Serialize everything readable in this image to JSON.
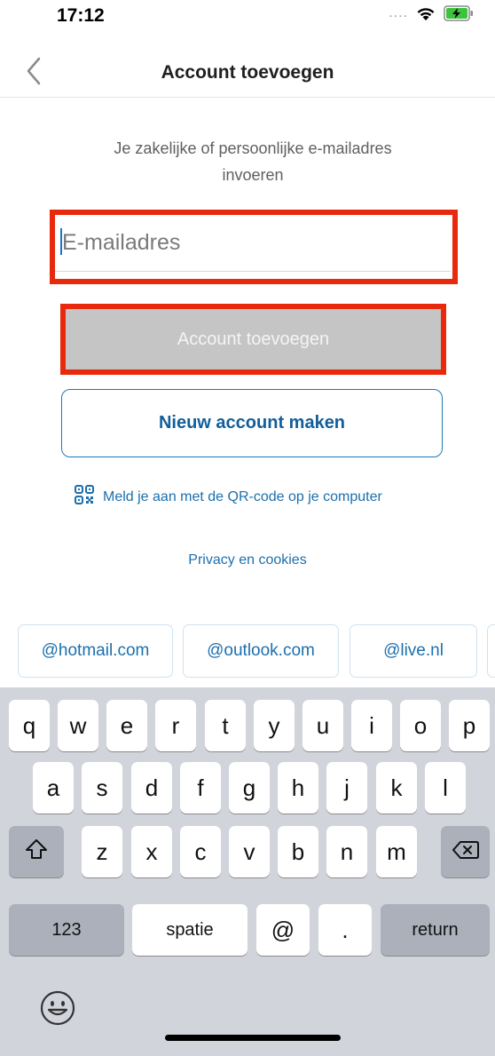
{
  "status_bar": {
    "time": "17:12",
    "signal": "....",
    "wifi_icon": "wifi-icon",
    "battery_icon": "battery-charging-icon"
  },
  "nav": {
    "back_icon": "chevron-left-icon",
    "title": "Account toevoegen"
  },
  "instruction": "Je zakelijke of persoonlijke e-mailadres invoeren",
  "email_field": {
    "value": "",
    "placeholder": "E-mailadres"
  },
  "buttons": {
    "add_account": "Account toevoegen",
    "create_account": "Nieuw account maken"
  },
  "qr_link": {
    "label": "Meld je aan met de QR-code op je computer",
    "icon": "qr-code-icon"
  },
  "privacy_link": "Privacy en cookies",
  "suggestions": [
    "@hotmail.com",
    "@outlook.com",
    "@live.nl"
  ],
  "keyboard": {
    "row1": [
      "q",
      "w",
      "e",
      "r",
      "t",
      "y",
      "u",
      "i",
      "o",
      "p"
    ],
    "row2": [
      "a",
      "s",
      "d",
      "f",
      "g",
      "h",
      "j",
      "k",
      "l"
    ],
    "row3": [
      "z",
      "x",
      "c",
      "v",
      "b",
      "n",
      "m"
    ],
    "numbers_label": "123",
    "space_label": "spatie",
    "at_label": "@",
    "dot_label": ".",
    "return_label": "return",
    "shift_icon": "shift-icon",
    "delete_icon": "delete-icon",
    "emoji_icon": "emoji-icon"
  },
  "colors": {
    "accent": "#1c6fad",
    "highlight": "#e8290b",
    "disabled_button": "#c5c5c5",
    "keyboard_bg": "#d1d4da"
  }
}
